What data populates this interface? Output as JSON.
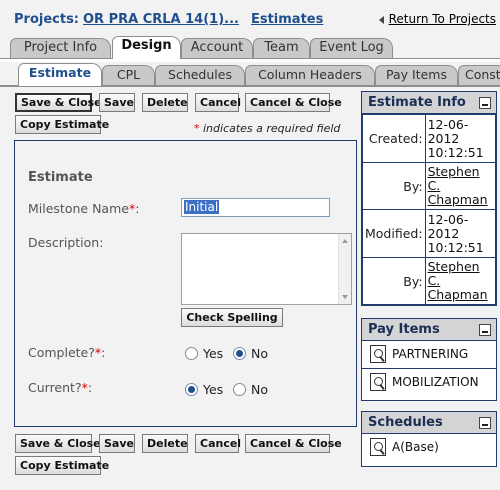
{
  "header": {
    "projects_label": "Projects:",
    "project_link": "OR PRA CRLA 14(1)...",
    "section_link": "Estimates",
    "return_link": "Return To Projects"
  },
  "main_tabs": [
    "Project Info",
    "Design",
    "Account",
    "Team",
    "Event Log"
  ],
  "sub_tabs": [
    "Estimate",
    "CPL",
    "Schedules",
    "Column Headers",
    "Pay Items",
    "Constru"
  ],
  "toolbar": {
    "save_close": "Save & Close",
    "save": "Save",
    "delete": "Delete",
    "cancel": "Cancel",
    "cancel_close": "Cancel & Close",
    "copy_estimate": "Copy Estimate"
  },
  "required_note": {
    "star": "*",
    "text": " indicates a required field"
  },
  "form": {
    "section_title": "Estimate",
    "milestone_label": "Milestone Name",
    "milestone_value": "Initial",
    "description_label": "Description:",
    "check_spelling": "Check Spelling",
    "complete_label": "Complete?",
    "current_label": "Current?",
    "yes": "Yes",
    "no": "No",
    "complete_value": "No",
    "current_value": "Yes"
  },
  "estimate_info": {
    "title": "Estimate Info",
    "created_label": "Created:",
    "created_date": "12-06-2012",
    "created_time": "10:12:51",
    "by_label": "By:",
    "created_by_first": "Stephen",
    "created_by_mid": "C.",
    "created_by_last": "Chapman",
    "modified_label": "Modified:",
    "modified_date": "12-06-2012",
    "modified_time": "10:12:51",
    "modified_by_first": "Stephen",
    "modified_by_mid": "C.",
    "modified_by_last": "Chapman"
  },
  "pay_items": {
    "title": "Pay Items",
    "items": [
      "PARTNERING",
      "MOBILIZATION"
    ]
  },
  "schedules": {
    "title": "Schedules",
    "items": [
      "A(Base)"
    ]
  }
}
